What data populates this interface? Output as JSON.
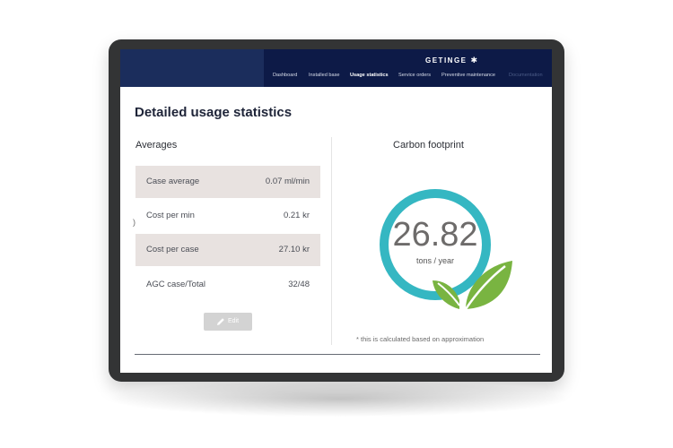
{
  "header": {
    "brand": "GETINGE",
    "brand_mark": "✱",
    "nav": [
      {
        "label": "Dashboard"
      },
      {
        "label": "Installed base"
      },
      {
        "label": "Usage statistics"
      },
      {
        "label": "Service orders"
      },
      {
        "label": "Preventive maintenance"
      },
      {
        "label": "Documentation"
      }
    ]
  },
  "page": {
    "title": "Detailed usage statistics"
  },
  "averages": {
    "title": "Averages",
    "rows": [
      {
        "label": "Case average",
        "value": "0.07 ml/min"
      },
      {
        "label": "Cost per min",
        "value": "0.21 kr"
      },
      {
        "label": "Cost per case",
        "value": "27.10 kr"
      },
      {
        "label": "AGC case/Total",
        "value": "32/48"
      }
    ],
    "edit_label": "Edit"
  },
  "carbon": {
    "title": "Carbon footprint",
    "value": "26.82",
    "unit": "tons / year",
    "note": "* this is calculated based on approximation",
    "ring_color": "#35b7c2",
    "leaf_color": "#79b441"
  }
}
